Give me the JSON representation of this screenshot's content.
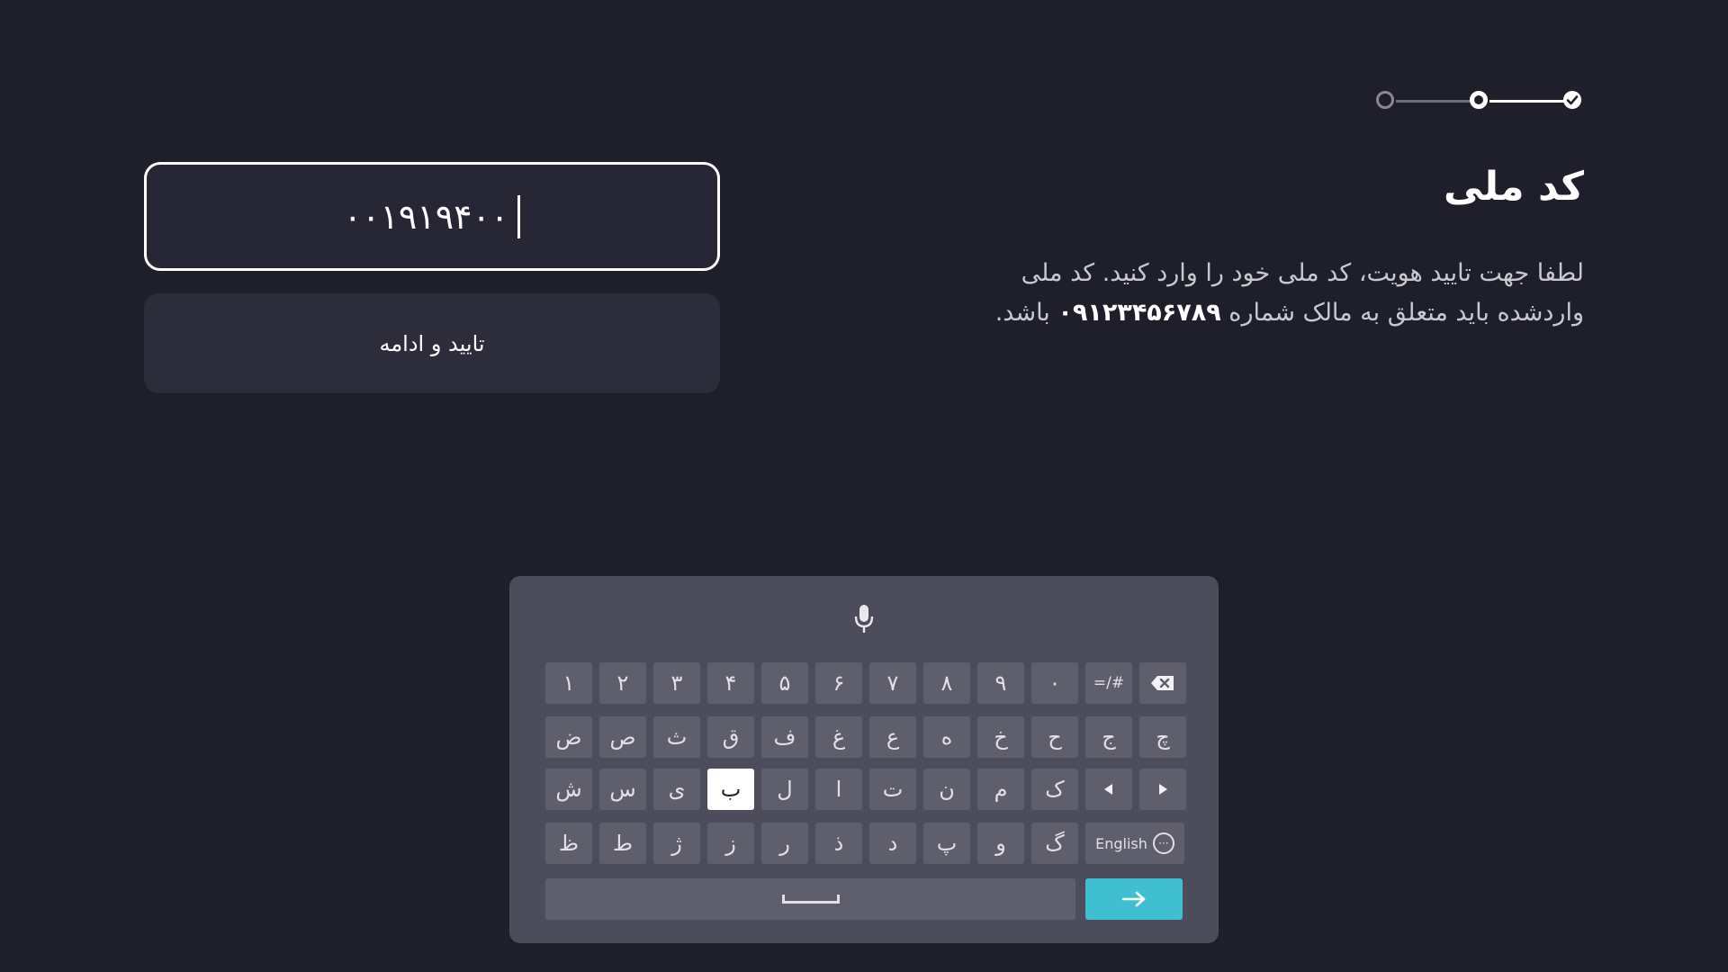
{
  "stepper": {
    "steps": [
      "upcoming",
      "current",
      "completed"
    ]
  },
  "title": "کد ملی",
  "description": {
    "line1": "لطفا جهت تایید هویت، کد ملی خود را وارد کنید. کد ملی",
    "line2_before": "واردشده باید متعلق به مالک شماره",
    "phone": "۰۹۱۲۳۴۵۶۷۸۹",
    "line2_after": "باشد."
  },
  "input": {
    "value": "۰۰۱۹۱۹۴۰۰"
  },
  "confirm_button": {
    "label": "تایید و ادامه"
  },
  "keyboard": {
    "row1": [
      "۱",
      "۲",
      "۳",
      "۴",
      "۵",
      "۶",
      "۷",
      "۸",
      "۹",
      "۰",
      "=/#"
    ],
    "row2": [
      "ض",
      "ص",
      "ث",
      "ق",
      "ف",
      "غ",
      "ع",
      "ه",
      "خ",
      "ح",
      "ج",
      "چ"
    ],
    "row3": [
      "ش",
      "س",
      "ی",
      "ب",
      "ل",
      "ا",
      "ت",
      "ن",
      "م",
      "ک"
    ],
    "row4": [
      "ظ",
      "ط",
      "ژ",
      "ز",
      "ر",
      "ذ",
      "د",
      "پ",
      "و",
      "گ"
    ],
    "language_label": "English",
    "selected_key": "ب",
    "colors": {
      "enter": "#3fbfd0",
      "key": "#5e5e6c",
      "panel": "#4c4c5a"
    }
  }
}
